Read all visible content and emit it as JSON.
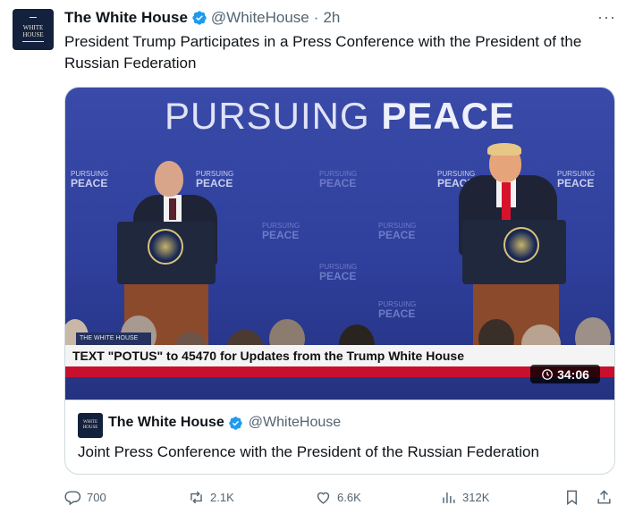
{
  "tweet": {
    "author_name": "The White House",
    "handle": "@WhiteHouse",
    "separator": "·",
    "time": "2h",
    "text": "President Trump Participates in a Press Conference with the President of the Russian Federation",
    "avatar_text_1": "WHITE",
    "avatar_text_2": "HOUSE"
  },
  "media": {
    "banner_light": "PURSUING ",
    "banner_bold": "PEACE",
    "watermark_top": "PURSUING",
    "watermark_bottom": "PEACE",
    "ticker_text": "TEXT \"POTUS\" to 45470 for Updates from the Trump White House",
    "channel_logo": "THE WHITE HOUSE",
    "duration": "34:06"
  },
  "quoted": {
    "author_name": "The White House",
    "handle": "@WhiteHouse",
    "text": "Joint Press Conference with the President of the Russian Federation",
    "avatar_text_1": "WHITE",
    "avatar_text_2": "HOUSE"
  },
  "actions": {
    "replies": "700",
    "reposts": "2.1K",
    "likes": "6.6K",
    "views": "312K"
  },
  "icons": {
    "verified": "verified-badge-icon",
    "reply": "reply-icon",
    "repost": "repost-icon",
    "like": "heart-icon",
    "views": "views-icon",
    "bookmark": "bookmark-icon",
    "share": "share-icon",
    "more": "more-icon",
    "clock": "clock-icon"
  },
  "colors": {
    "verified": "#1d9bf0",
    "secondary_text": "#536471",
    "ticker_red": "#c8102e",
    "media_blue": "#2f3f9c"
  }
}
